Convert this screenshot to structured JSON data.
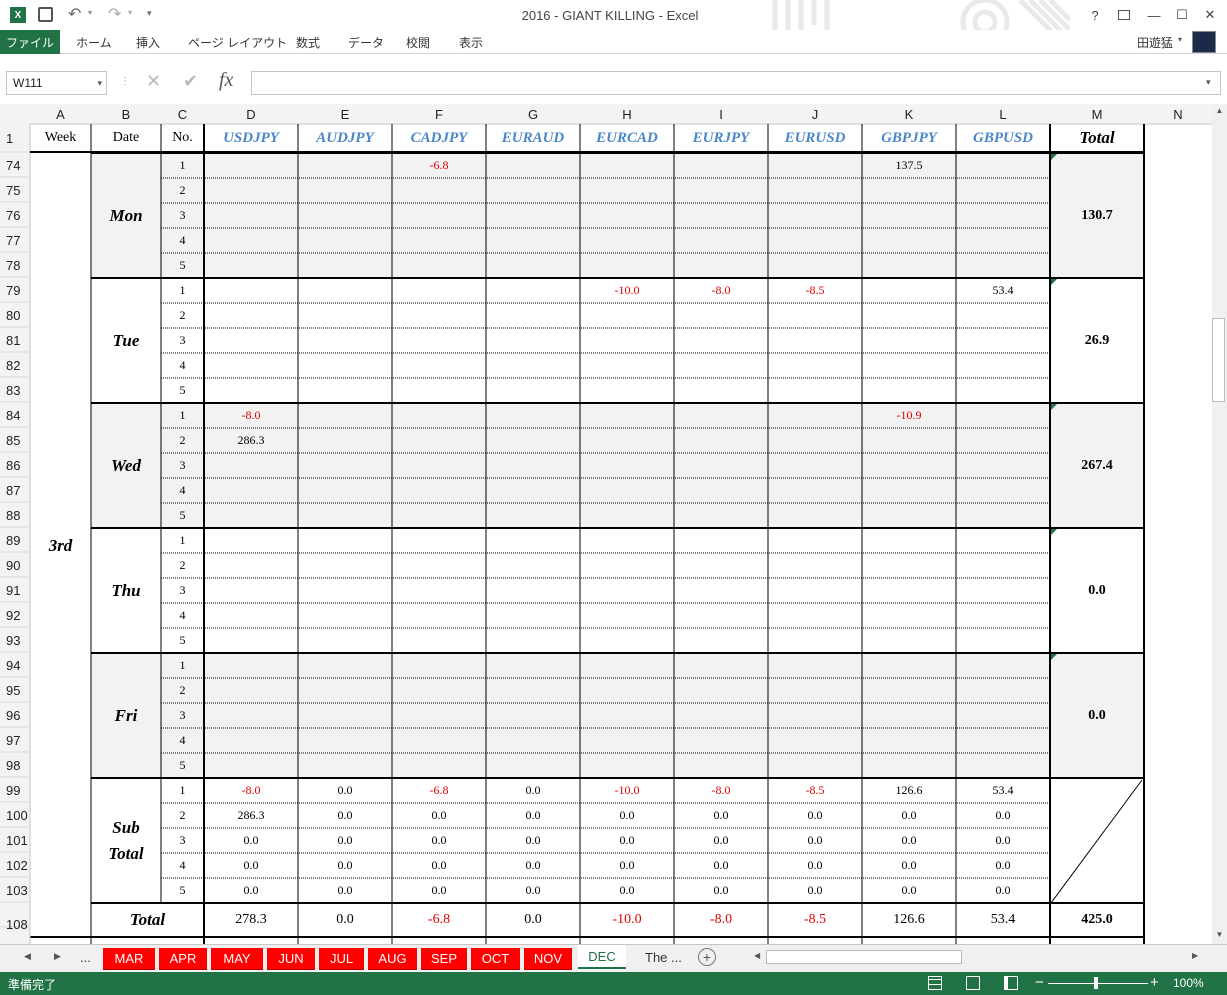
{
  "window": {
    "title": "2016 - GIANT KILLING - Excel",
    "user": "田遊猛",
    "help": "?",
    "minimize": "—",
    "maximize": "☐",
    "close": "✕"
  },
  "ribbon": {
    "file": "ファイル",
    "tabs": [
      "ホーム",
      "挿入",
      "ページ レイアウト",
      "数式",
      "データ",
      "校閲",
      "表示"
    ]
  },
  "formula": {
    "namebox": "W111",
    "fx": "fx",
    "value": ""
  },
  "columns": [
    "A",
    "B",
    "C",
    "D",
    "E",
    "F",
    "G",
    "H",
    "I",
    "J",
    "K",
    "L",
    "M",
    "N"
  ],
  "header": {
    "rownum": "1",
    "week": "Week",
    "date": "Date",
    "no": "No.",
    "pairs": [
      "USDJPY",
      "AUDJPY",
      "CADJPY",
      "EURAUD",
      "EURCAD",
      "EURJPY",
      "EURUSD",
      "GBPJPY",
      "GBPUSD"
    ],
    "total": "Total"
  },
  "week_label": "3rd",
  "days": [
    {
      "name": "Mon",
      "rows": [
        "74",
        "75",
        "76",
        "77",
        "78"
      ],
      "total": "130.7",
      "entries": [
        {
          "row": 0,
          "col": 2,
          "value": "-6.8"
        },
        {
          "row": 0,
          "col": 7,
          "value": "137.5"
        }
      ]
    },
    {
      "name": "Tue",
      "rows": [
        "79",
        "80",
        "81",
        "82",
        "83"
      ],
      "total": "26.9",
      "entries": [
        {
          "row": 0,
          "col": 4,
          "value": "-10.0"
        },
        {
          "row": 0,
          "col": 5,
          "value": "-8.0"
        },
        {
          "row": 0,
          "col": 6,
          "value": "-8.5"
        },
        {
          "row": 0,
          "col": 8,
          "value": "53.4"
        }
      ]
    },
    {
      "name": "Wed",
      "rows": [
        "84",
        "85",
        "86",
        "87",
        "88"
      ],
      "total": "267.4",
      "entries": [
        {
          "row": 0,
          "col": 0,
          "value": "-8.0"
        },
        {
          "row": 0,
          "col": 7,
          "value": "-10.9"
        },
        {
          "row": 1,
          "col": 0,
          "value": "286.3"
        }
      ]
    },
    {
      "name": "Thu",
      "rows": [
        "89",
        "90",
        "91",
        "92",
        "93"
      ],
      "total": "0.0",
      "entries": []
    },
    {
      "name": "Fri",
      "rows": [
        "94",
        "95",
        "96",
        "97",
        "98"
      ],
      "total": "0.0",
      "entries": []
    }
  ],
  "nos": [
    "1",
    "2",
    "3",
    "4",
    "5"
  ],
  "subtotal": {
    "label1": "Sub",
    "label2": "Total",
    "rows": [
      "99",
      "100",
      "101",
      "102",
      "103"
    ],
    "values": [
      [
        "-8.0",
        "0.0",
        "-6.8",
        "0.0",
        "-10.0",
        "-8.0",
        "-8.5",
        "126.6",
        "53.4"
      ],
      [
        "286.3",
        "0.0",
        "0.0",
        "0.0",
        "0.0",
        "0.0",
        "0.0",
        "0.0",
        "0.0"
      ],
      [
        "0.0",
        "0.0",
        "0.0",
        "0.0",
        "0.0",
        "0.0",
        "0.0",
        "0.0",
        "0.0"
      ],
      [
        "0.0",
        "0.0",
        "0.0",
        "0.0",
        "0.0",
        "0.0",
        "0.0",
        "0.0",
        "0.0"
      ],
      [
        "0.0",
        "0.0",
        "0.0",
        "0.0",
        "0.0",
        "0.0",
        "0.0",
        "0.0",
        "0.0"
      ]
    ]
  },
  "total_row": {
    "rownum": "108",
    "label": "Total",
    "values": [
      "278.3",
      "0.0",
      "-6.8",
      "0.0",
      "-10.0",
      "-8.0",
      "-8.5",
      "126.6",
      "53.4"
    ],
    "grand": "425.0"
  },
  "sheet_tabs": {
    "ellipsis": "...",
    "items": [
      "MAR",
      "APR",
      "MAY",
      "JUN",
      "JUL",
      "AUG",
      "SEP",
      "OCT",
      "NOV"
    ],
    "active": "DEC",
    "more": "The ..."
  },
  "statusbar": {
    "ready": "準備完了",
    "zoom": "100%"
  },
  "colors": {
    "excel_green": "#217346",
    "negative": "#e00000",
    "pair_header": "#4a86c8",
    "band_gray": "#f2f2f2"
  }
}
